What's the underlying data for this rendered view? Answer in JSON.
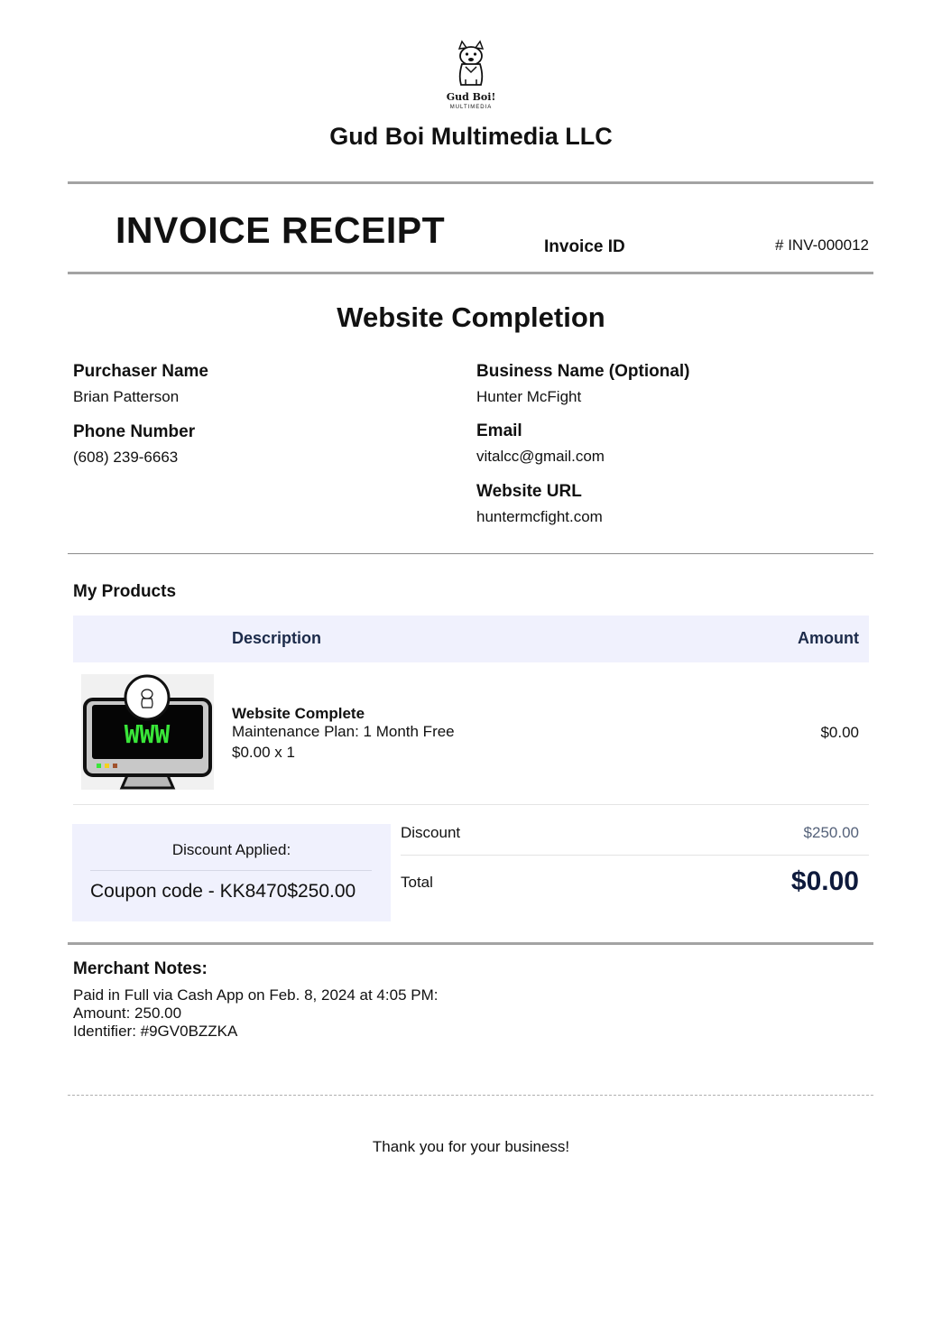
{
  "header": {
    "logo_text": "Gud Boi!",
    "logo_subtext": "MULTIMEDIA",
    "company_name": "Gud Boi Multimedia LLC"
  },
  "invoice": {
    "title": "INVOICE RECEIPT",
    "id_label": "Invoice ID",
    "id_value": "# INV-000012"
  },
  "section_title": "Website Completion",
  "customer": {
    "purchaser_label": "Purchaser Name",
    "purchaser_value": "Brian Patterson",
    "phone_label": "Phone Number",
    "phone_value": "(608) 239-6663",
    "business_label": "Business Name (Optional)",
    "business_value": "Hunter McFight",
    "email_label": "Email",
    "email_value": "vitalcc@gmail.com",
    "url_label": "Website URL",
    "url_value": "huntermcfight.com"
  },
  "products": {
    "title": "My Products",
    "col_description": "Description",
    "col_amount": "Amount",
    "items": [
      {
        "name": "Website Complete",
        "description": "Maintenance Plan: 1 Month Free",
        "qty_line": "$0.00 x 1",
        "amount": "$0.00",
        "image_icon": "website-monitor-icon",
        "image_text": "WWW"
      }
    ]
  },
  "discount": {
    "applied_label": "Discount Applied:",
    "coupon_text": "Coupon code - KK8470$250.00",
    "discount_label": "Discount",
    "discount_value": "$250.00",
    "total_label": "Total",
    "total_value": "$0.00"
  },
  "notes": {
    "title": "Merchant Notes:",
    "lines": [
      "Paid in Full via Cash App on Feb. 8, 2024 at 4:05 PM:",
      "Amount: 250.00",
      "Identifier: #9GV0BZZKA"
    ]
  },
  "footer": {
    "thanks": "Thank you for your business!"
  },
  "colors": {
    "table_header_bg": "#f0f1fd",
    "heading_dark": "#1c2b4a",
    "total_color": "#0e1a3c",
    "www_green": "#39e639"
  }
}
